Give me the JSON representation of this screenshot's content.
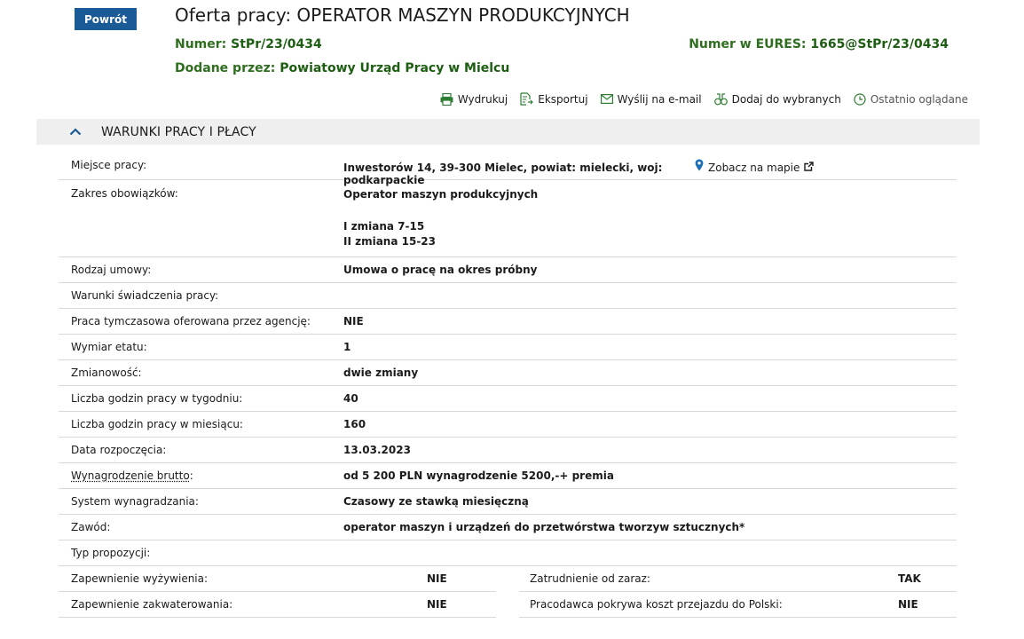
{
  "header": {
    "back_label": "Powrót",
    "title": "Oferta pracy: OPERATOR MASZYN PRODUKCYJNYCH",
    "number_label": "Numer:",
    "number_value": "StPr/23/0434",
    "eures_label": "Numer w EURES:",
    "eures_value": "1665@StPr/23/0434",
    "added_label": "Dodane przez:",
    "added_value": "Powiatowy Urząd Pracy w Mielcu"
  },
  "toolbar": {
    "print": "Wydrukuj",
    "export": "Eksportuj",
    "email": "Wyślij na e-mail",
    "favorite": "Dodaj do wybranych",
    "recent": "Ostatnio oglądane"
  },
  "section": {
    "title": "WARUNKI PRACY I PŁACY"
  },
  "details": {
    "location_label": "Miejsce pracy:",
    "location_value": "Inwestorów 14, 39-300 Mielec, powiat: mielecki, woj: podkarpackie",
    "map_link": "Zobacz na mapie",
    "duties_label": "Zakres obowiązków:",
    "duties_line1": "Operator maszyn produkcyjnych",
    "duties_line2": "I zmiana 7-15",
    "duties_line3": "II zmiana 15-23",
    "rows": [
      {
        "label": "Rodzaj umowy:",
        "value": "Umowa o pracę na okres próbny"
      },
      {
        "label": "Warunki świadczenia pracy:",
        "value": ""
      },
      {
        "label": "Praca tymczasowa oferowana przez agencję:",
        "value": "NIE"
      },
      {
        "label": "Wymiar etatu:",
        "value": "1"
      },
      {
        "label": "Zmianowość:",
        "value": "dwie zmiany"
      },
      {
        "label": "Liczba godzin pracy w tygodniu:",
        "value": "40"
      },
      {
        "label": "Liczba godzin pracy w miesiącu:",
        "value": "160"
      },
      {
        "label": "Data rozpoczęcia:",
        "value": "13.03.2023"
      },
      {
        "label": "Wynagrodzenie brutto",
        "value": "od 5 200 PLN wynagrodzenie 5200,-+ premia"
      },
      {
        "label": "System wynagradzania:",
        "value": "Czasowy ze stawką miesięczną"
      },
      {
        "label": "Zawód:",
        "value": "operator maszyn i urządzeń do przetwórstwa tworzyw sztucznych*"
      },
      {
        "label": "Typ propozycji:",
        "value": ""
      }
    ],
    "salary_colon": ":",
    "left_pairs": [
      {
        "label": "Zapewnienie wyżywienia:",
        "value": "NIE"
      },
      {
        "label": "Zapewnienie zakwaterowania:",
        "value": "NIE"
      }
    ],
    "right_pairs": [
      {
        "label": "Zatrudnienie od zaraz:",
        "value": "TAK"
      },
      {
        "label": "Pracodawca pokrywa koszt przejazdu do Polski:",
        "value": "NIE"
      }
    ]
  },
  "colors": {
    "primary_button": "#1a5a96",
    "meta_green": "#2e6e1e",
    "section_bg": "#efefef",
    "map_pin": "#1a6fb5"
  }
}
